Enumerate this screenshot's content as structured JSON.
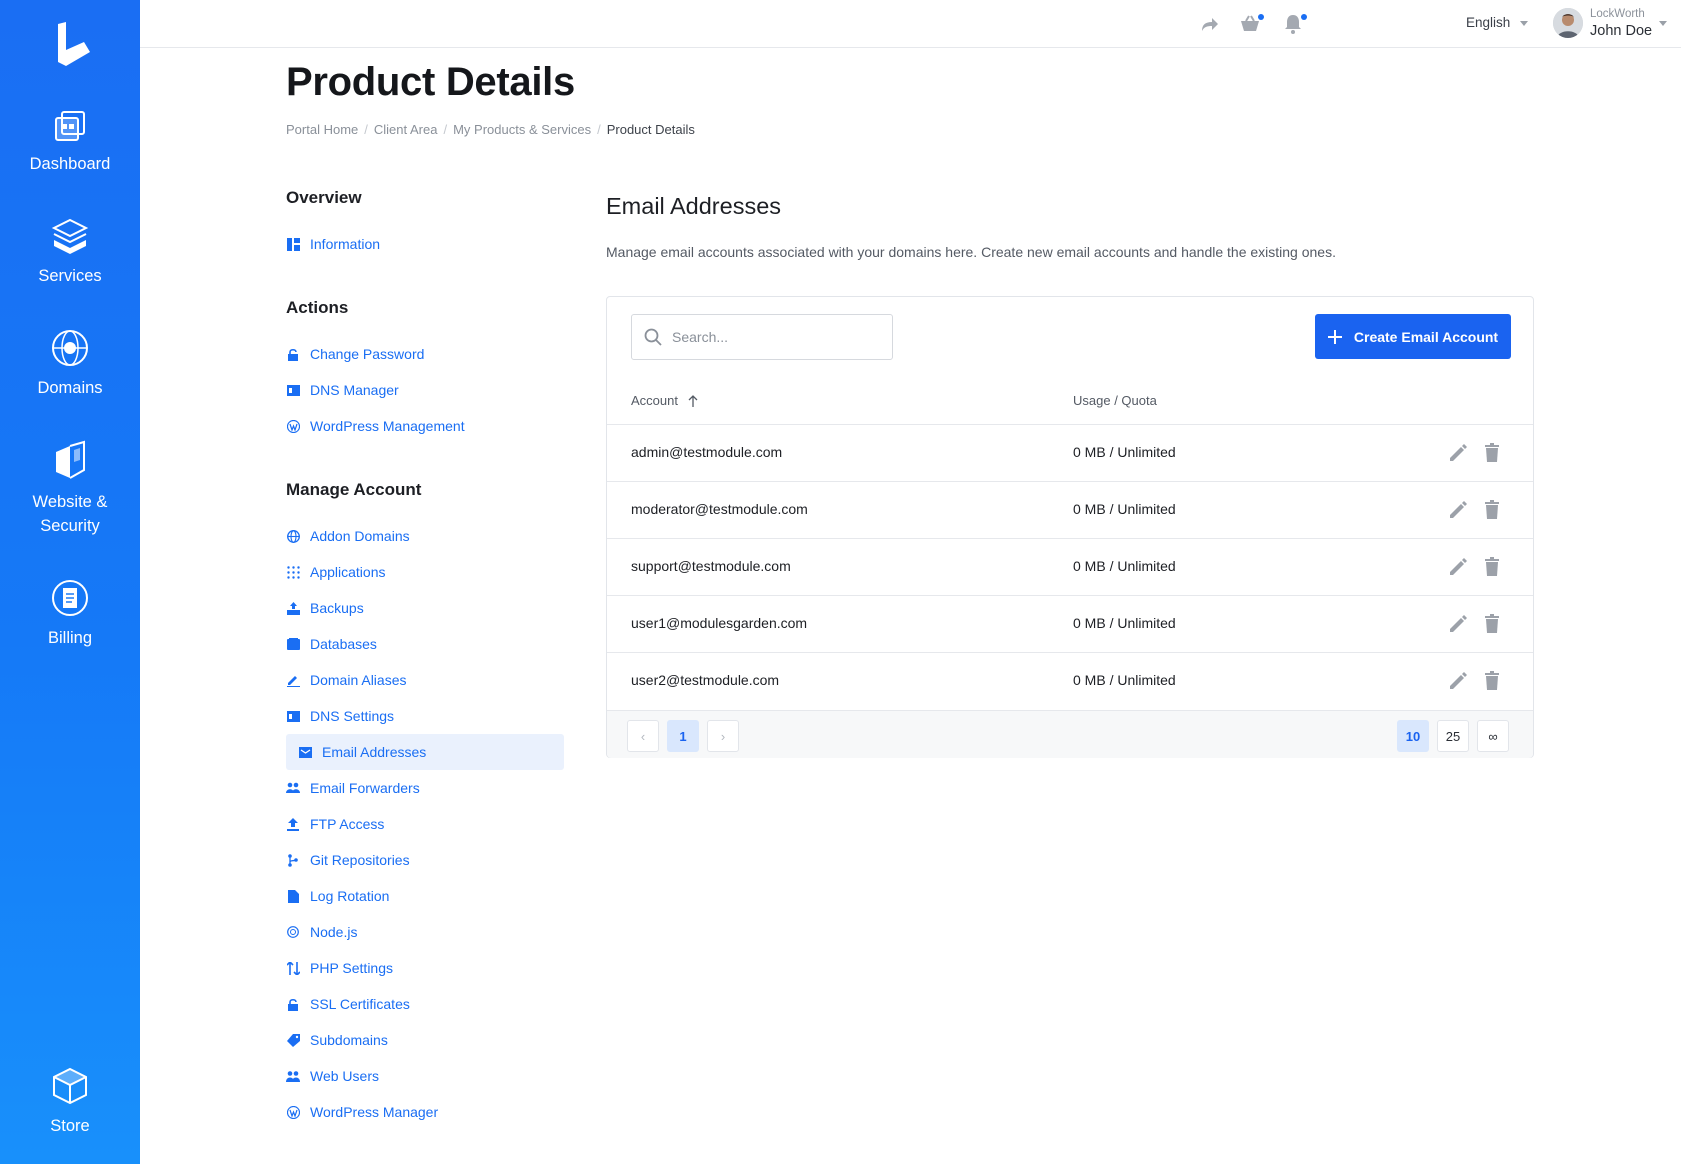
{
  "nav": {
    "items": [
      {
        "label": "Dashboard",
        "icon": "dashboard-icon"
      },
      {
        "label": "Services",
        "icon": "services-icon"
      },
      {
        "label": "Domains",
        "icon": "domains-icon"
      },
      {
        "label": "Website & Security",
        "icon": "website-security-icon"
      },
      {
        "label": "Billing",
        "icon": "billing-icon"
      },
      {
        "label": "Store",
        "icon": "store-icon"
      }
    ]
  },
  "topbar": {
    "language": "English",
    "user": {
      "org": "LockWorth",
      "name": "John Doe"
    }
  },
  "page": {
    "title": "Product Details",
    "breadcrumb": [
      "Portal Home",
      "Client Area",
      "My Products & Services",
      "Product Details"
    ]
  },
  "sidebar": {
    "overview_title": "Overview",
    "overview": [
      {
        "label": "Information",
        "icon": "dashboard-grid-icon"
      }
    ],
    "actions_title": "Actions",
    "actions": [
      {
        "label": "Change Password",
        "icon": "lock-icon"
      },
      {
        "label": "DNS Manager",
        "icon": "dns-icon"
      },
      {
        "label": "WordPress Management",
        "icon": "wordpress-icon"
      }
    ],
    "manage_title": "Manage Account",
    "manage": [
      {
        "label": "Addon Domains",
        "icon": "globe-icon"
      },
      {
        "label": "Applications",
        "icon": "apps-grid-icon"
      },
      {
        "label": "Backups",
        "icon": "backup-icon"
      },
      {
        "label": "Databases",
        "icon": "database-icon"
      },
      {
        "label": "Domain Aliases",
        "icon": "pencil-icon"
      },
      {
        "label": "DNS Settings",
        "icon": "dns-icon"
      },
      {
        "label": "Email Addresses",
        "icon": "envelope-icon",
        "active": true
      },
      {
        "label": "Email Forwarders",
        "icon": "forwarders-icon"
      },
      {
        "label": "FTP Access",
        "icon": "upload-icon"
      },
      {
        "label": "Git Repositories",
        "icon": "git-icon"
      },
      {
        "label": "Log Rotation",
        "icon": "file-icon"
      },
      {
        "label": "Node.js",
        "icon": "nodejs-icon"
      },
      {
        "label": "PHP Settings",
        "icon": "sliders-icon"
      },
      {
        "label": "SSL Certificates",
        "icon": "lock-icon"
      },
      {
        "label": "Subdomains",
        "icon": "tag-icon"
      },
      {
        "label": "Web Users",
        "icon": "users-icon"
      },
      {
        "label": "WordPress Manager",
        "icon": "wordpress-icon"
      }
    ]
  },
  "main": {
    "title": "Email Addresses",
    "description": "Manage email accounts associated with your domains here. Create new email accounts and handle the existing ones.",
    "search_placeholder": "Search...",
    "create_label": "Create Email Account",
    "columns": {
      "account": "Account",
      "quota": "Usage / Quota"
    },
    "rows": [
      {
        "account": "admin@testmodule.com",
        "quota": "0 MB / Unlimited"
      },
      {
        "account": "moderator@testmodule.com",
        "quota": "0 MB / Unlimited"
      },
      {
        "account": "support@testmodule.com",
        "quota": "0 MB / Unlimited"
      },
      {
        "account": "user1@modulesgarden.com",
        "quota": "0 MB / Unlimited"
      },
      {
        "account": "user2@testmodule.com",
        "quota": "0 MB / Unlimited"
      }
    ],
    "pagination": {
      "current": "1",
      "prev": "‹",
      "next": "›",
      "page_sizes": [
        "10",
        "25",
        "∞"
      ],
      "active_size": "10"
    }
  },
  "colors": {
    "accent": "#1a63f0",
    "rail": "#1a6ef3",
    "active_bg": "#eaf1fd"
  }
}
